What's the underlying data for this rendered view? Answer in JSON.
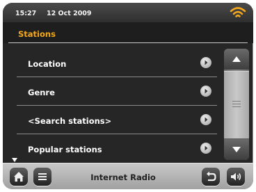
{
  "status": {
    "time": "15:27",
    "date": "12 Oct  2009",
    "wifi_icon": "wifi-icon",
    "wifi_color": "#f4a81e"
  },
  "header": {
    "title": "Stations",
    "title_color": "#f4a81e"
  },
  "menu": {
    "items": [
      {
        "label": "Location"
      },
      {
        "label": "Genre"
      },
      {
        "label": "<Search stations>"
      },
      {
        "label": "Popular stations"
      }
    ],
    "item_icon": "chevron-right-circle-icon",
    "more_below_icon": "triangle-down-icon"
  },
  "scrollbar": {
    "up_icon": "scroll-up-icon",
    "down_icon": "scroll-down-icon"
  },
  "footer": {
    "mode_label": "Internet Radio",
    "home_icon": "home-icon",
    "menu_icon": "menu-icon",
    "back_icon": "back-icon",
    "volume_icon": "volume-icon"
  }
}
